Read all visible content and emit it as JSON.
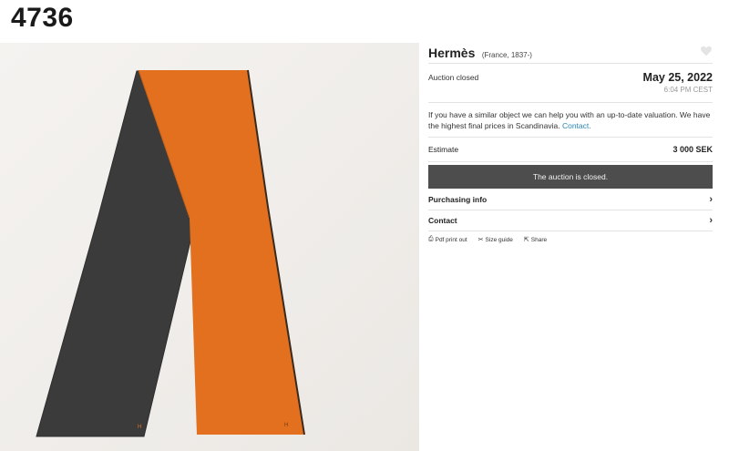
{
  "lot": {
    "number": "4736"
  },
  "object": {
    "artist": "Hermès",
    "origin": "(France, 1837-)"
  },
  "auction": {
    "status": "Auction closed",
    "date": "May 25, 2022",
    "time": "6:04 PM CEST",
    "valuation_text": "If you have a similar object we can help you with an up-to-date valuation. We have the highest final prices in Scandinavia.",
    "valuation_link": "Contact.",
    "estimate_label": "Estimate",
    "estimate_value": "3 000 SEK",
    "closed_message": "The auction is closed."
  },
  "links": {
    "purchasing_info": "Purchasing info",
    "contact": "Contact",
    "chevron": "›"
  },
  "tools": {
    "pdf": "Pdf print out",
    "size_guide": "Size guide",
    "share": "Share"
  },
  "icons": [
    "heart-icon",
    "printer-icon",
    "scissors-icon",
    "share-icon",
    "chevron-right-icon"
  ],
  "colors": {
    "scarf_orange": "#e2701f",
    "scarf_grey": "#3b3b3b",
    "closed_bar": "#4d4d4d",
    "link": "#2a86b8"
  }
}
